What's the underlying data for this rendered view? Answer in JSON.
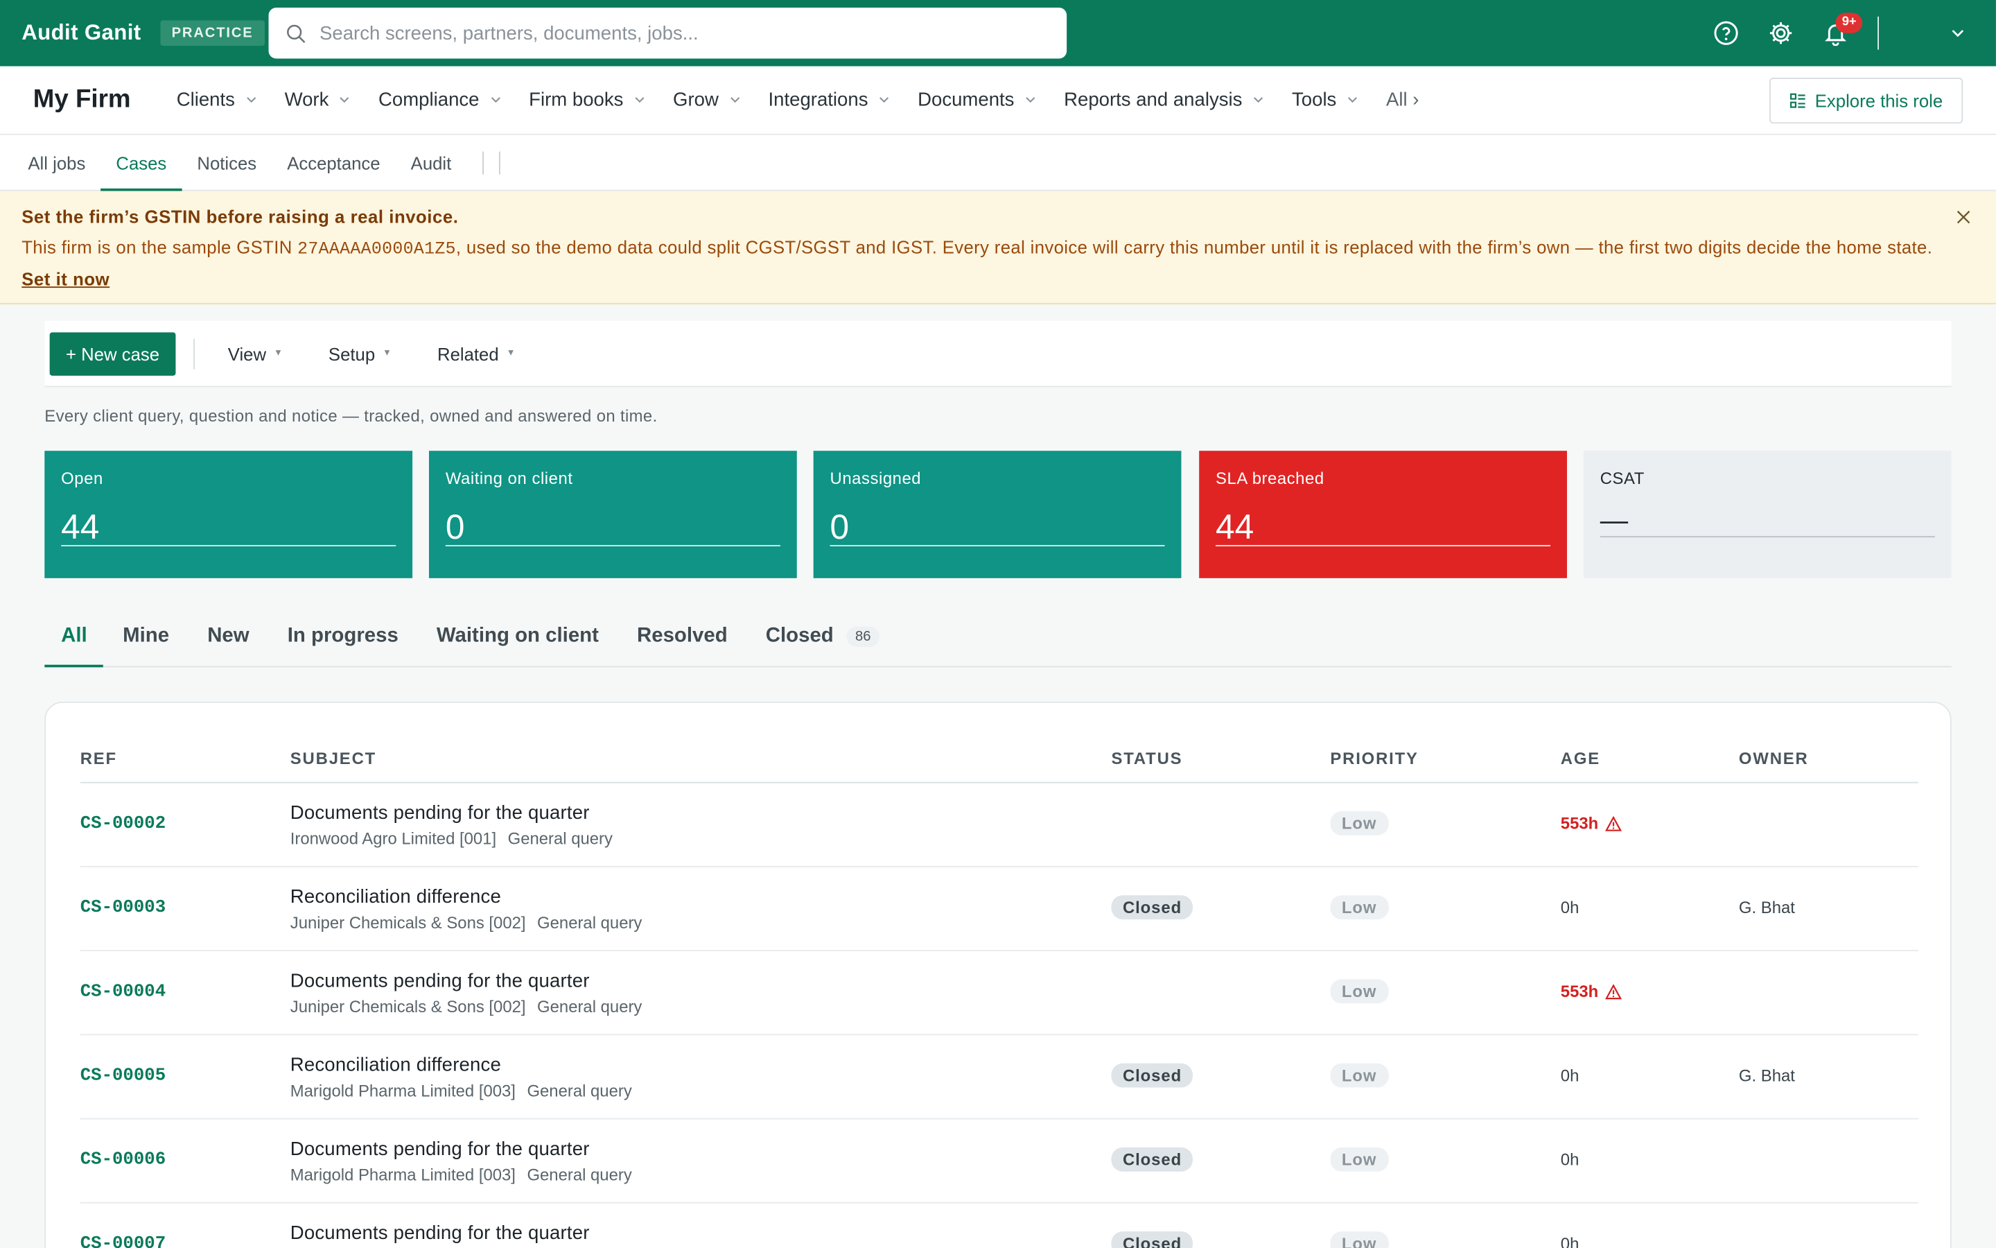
{
  "app": {
    "brand": "Audit Ganit",
    "mode_badge": "PRACTICE"
  },
  "search": {
    "placeholder": "Search screens, partners, documents, jobs..."
  },
  "notifications": {
    "count": "9+"
  },
  "nav": {
    "firm_name": "My Firm",
    "items": [
      "Clients",
      "Work",
      "Compliance",
      "Firm books",
      "Grow",
      "Integrations",
      "Documents",
      "Reports and analysis",
      "Tools"
    ],
    "all_label": "All ›",
    "explore_label": "Explore this role"
  },
  "subtabs": {
    "items": [
      "All jobs",
      "Cases",
      "Notices",
      "Acceptance",
      "Audit"
    ],
    "active": "Cases"
  },
  "alert": {
    "title": "Set the firm’s GSTIN before raising a real invoice.",
    "body_prefix": "This firm is on the sample GSTIN ",
    "gstin": "27AAAAA0000A1Z5",
    "body_suffix": ", used so the demo data could split CGST/SGST and IGST. Every real invoice will carry this number until it is replaced with the firm’s own — the first two digits decide the home state.",
    "link": "Set it now"
  },
  "toolbar": {
    "new_case": "+ New case",
    "menus": [
      "View",
      "Setup",
      "Related"
    ]
  },
  "description": "Every client query, question and notice — tracked, owned and answered on time.",
  "kpis": [
    {
      "label": "Open",
      "value": "44",
      "color": "#0f9485"
    },
    {
      "label": "Waiting on client",
      "value": "0",
      "color": "#0f9485"
    },
    {
      "label": "Unassigned",
      "value": "0",
      "color": "#0f9485"
    },
    {
      "label": "SLA breached",
      "value": "44",
      "color": "#e02424"
    },
    {
      "label": "CSAT",
      "value": "—",
      "color": "#eceff2"
    }
  ],
  "filter_tabs": {
    "items": [
      "All",
      "Mine",
      "New",
      "In progress",
      "Waiting on client",
      "Resolved",
      "Closed"
    ],
    "active": "All",
    "closed_count": "86"
  },
  "table": {
    "columns": [
      "REF",
      "SUBJECT",
      "STATUS",
      "PRIORITY",
      "AGE",
      "OWNER"
    ],
    "rows": [
      {
        "ref": "CS-00002",
        "subject": "Documents pending for the quarter",
        "client": "Ironwood Agro Limited [001]",
        "type": "General query",
        "status": "",
        "priority": "Low",
        "age": "553h",
        "breach": true,
        "owner": ""
      },
      {
        "ref": "CS-00003",
        "subject": "Reconciliation difference",
        "client": "Juniper Chemicals & Sons [002]",
        "type": "General query",
        "status": "Closed",
        "priority": "Low",
        "age": "0h",
        "breach": false,
        "owner": "G. Bhat"
      },
      {
        "ref": "CS-00004",
        "subject": "Documents pending for the quarter",
        "client": "Juniper Chemicals & Sons [002]",
        "type": "General query",
        "status": "",
        "priority": "Low",
        "age": "553h",
        "breach": true,
        "owner": ""
      },
      {
        "ref": "CS-00005",
        "subject": "Reconciliation difference",
        "client": "Marigold Pharma Limited [003]",
        "type": "General query",
        "status": "Closed",
        "priority": "Low",
        "age": "0h",
        "breach": false,
        "owner": "G. Bhat"
      },
      {
        "ref": "CS-00006",
        "subject": "Documents pending for the quarter",
        "client": "Marigold Pharma Limited [003]",
        "type": "General query",
        "status": "Closed",
        "priority": "Low",
        "age": "0h",
        "breach": false,
        "owner": ""
      },
      {
        "ref": "CS-00007",
        "subject": "Documents pending for the quarter",
        "client": "",
        "type": "",
        "status": "Closed",
        "priority": "Low",
        "age": "0h",
        "breach": false,
        "owner": ""
      }
    ]
  }
}
